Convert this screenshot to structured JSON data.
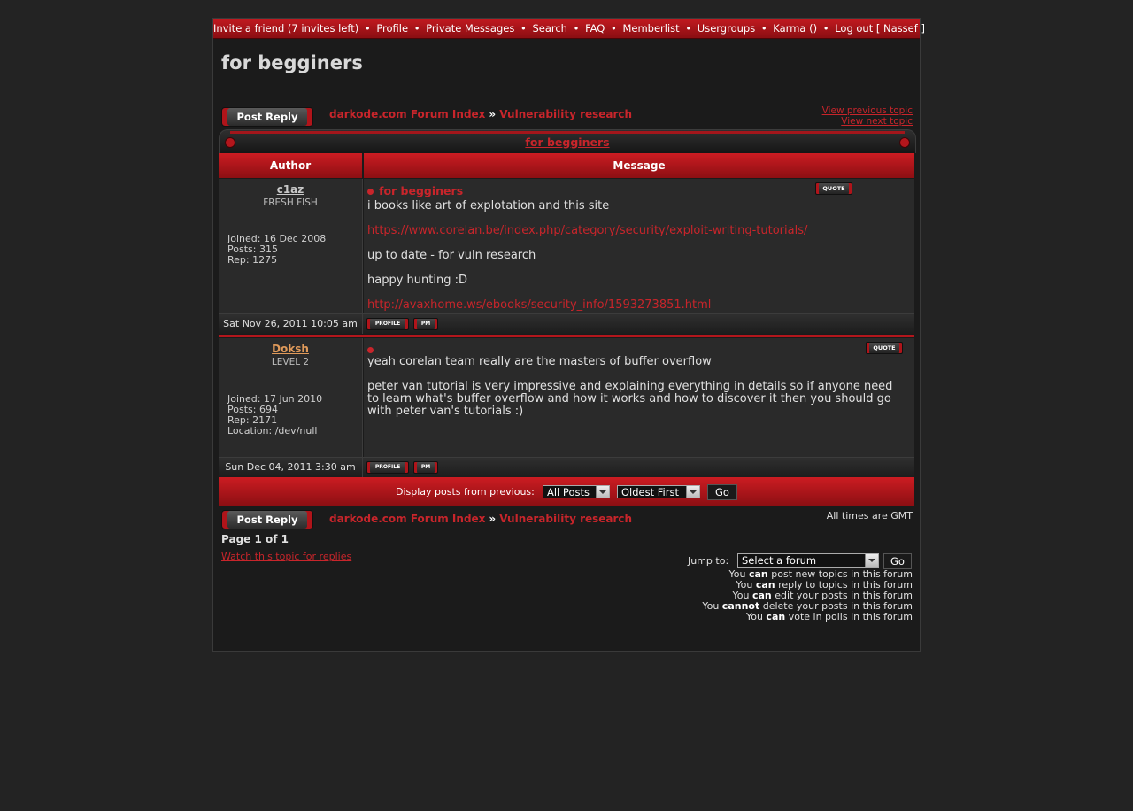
{
  "nav": {
    "items": [
      "Invite a friend (7 invites left)",
      "Profile",
      "Private Messages",
      "Search",
      "FAQ",
      "Memberlist",
      "Usergroups",
      "Karma ()",
      "Log out [ Nassef ]"
    ],
    "separator": "•"
  },
  "page_title": "for begginers",
  "post_reply_label": "Post Reply",
  "breadcrumb": {
    "index": "darkode.com Forum Index",
    "sep": "»",
    "forum": "Vulnerability research"
  },
  "topic_links": {
    "prev": "View previous topic",
    "next": "View next topic"
  },
  "table": {
    "title": "for begginers",
    "author_header": "Author",
    "message_header": "Message"
  },
  "posts": [
    {
      "author": "c1az",
      "rank": "FRESH FISH",
      "details": [
        "Joined: 16 Dec 2008",
        "Posts: 315",
        "Rep: 1275"
      ],
      "subject": "for begginers",
      "body": [
        "i books like art of explotation and this site",
        "https://www.corelan.be/index.php/category/security/exploit-writing-tutorials/",
        "up to date - for vuln research",
        "happy hunting :D",
        "http://avaxhome.ws/ebooks/security_info/1593273851.html"
      ],
      "date": "Sat Nov 26, 2011 10:05 am",
      "author_color": "#c9c9c9"
    },
    {
      "author": "Doksh",
      "rank": "LEVEL 2",
      "details": [
        "Joined: 17 Jun 2010",
        "Posts: 694",
        "Rep: 2171",
        "Location: /dev/null"
      ],
      "subject": "",
      "body": [
        "yeah corelan team really are the masters of buffer overflow",
        "peter van tutorial is very impressive and explaining everything in details so if anyone need to learn what's buffer overflow and how it works and how to discover it then you should go with peter van's tutorials :)"
      ],
      "date": "Sun Dec 04, 2011 3:30 am",
      "author_color": "#e09a5a"
    }
  ],
  "buttons": {
    "quote": "QUOTE",
    "profile": "PROFILE",
    "pm": "PM"
  },
  "display": {
    "label": "Display posts from previous:",
    "range_value": "All Posts",
    "order_value": "Oldest First",
    "go": "Go"
  },
  "times": "All times are GMT",
  "page_info": "Page 1 of 1",
  "watch": "Watch this topic for replies",
  "jump": {
    "label": "Jump to:",
    "value": "Select a forum",
    "go": "Go"
  },
  "permissions": [
    {
      "pre": "You ",
      "b": "can",
      "post": " post new topics in this forum"
    },
    {
      "pre": "You ",
      "b": "can",
      "post": " reply to topics in this forum"
    },
    {
      "pre": "You ",
      "b": "can",
      "post": " edit your posts in this forum"
    },
    {
      "pre": "You ",
      "b": "cannot",
      "post": " delete your posts in this forum"
    },
    {
      "pre": "You ",
      "b": "can",
      "post": " vote in polls in this forum"
    }
  ]
}
